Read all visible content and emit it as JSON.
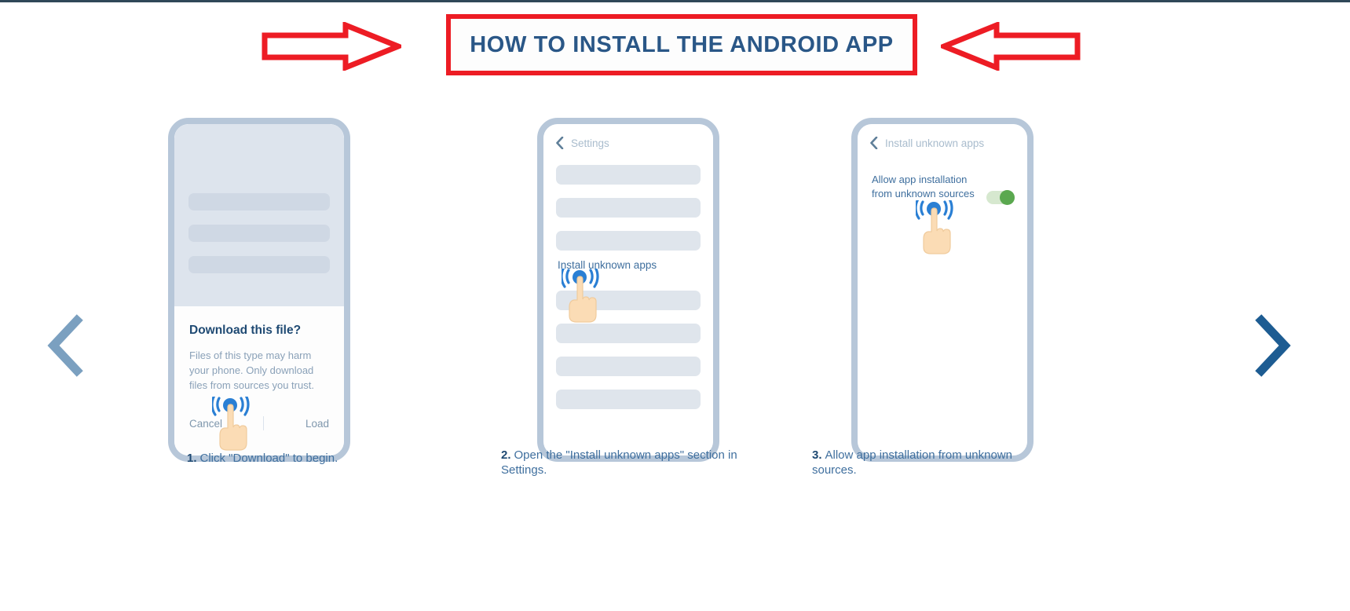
{
  "page": {
    "title": "HOW TO INSTALL THE ANDROID APP",
    "accent_red": "#ed1c24",
    "accent_blue": "#2a5787",
    "muted_blue": "#3f6f9e",
    "toggle_on_color": "#5aa84f"
  },
  "decor": {
    "left_arrow_icon": "arrow-right-outline-icon",
    "right_arrow_icon": "arrow-left-outline-icon"
  },
  "carousel": {
    "prev_icon": "chevron-left-icon",
    "next_icon": "chevron-right-icon",
    "prev_color": "#7ba0c0",
    "next_color": "#1d5c92"
  },
  "steps": [
    {
      "number": "1.",
      "caption": "Click \"Download\" to begin.",
      "phone": {
        "dialog_title": "Download this file?",
        "dialog_body": "Files of this type may harm your phone. Only download files from sources you trust.",
        "cancel_label": "Cancel",
        "confirm_label": "Load",
        "tap_icon": "tap-gesture-icon"
      }
    },
    {
      "number": "2.",
      "caption": "Open the \"Install unknown apps\" section in Settings.",
      "phone": {
        "header_label": "Settings",
        "back_icon": "chevron-left-icon",
        "menu_item": "Install unknown apps",
        "tap_icon": "tap-gesture-icon"
      }
    },
    {
      "number": "3.",
      "caption": "Allow app installation from unknown sources.",
      "phone": {
        "header_label": "Install unknown apps",
        "back_icon": "chevron-left-icon",
        "setting_label": "Allow app installation from unknown sources",
        "toggle_state": "on",
        "tap_icon": "tap-gesture-icon"
      }
    }
  ]
}
